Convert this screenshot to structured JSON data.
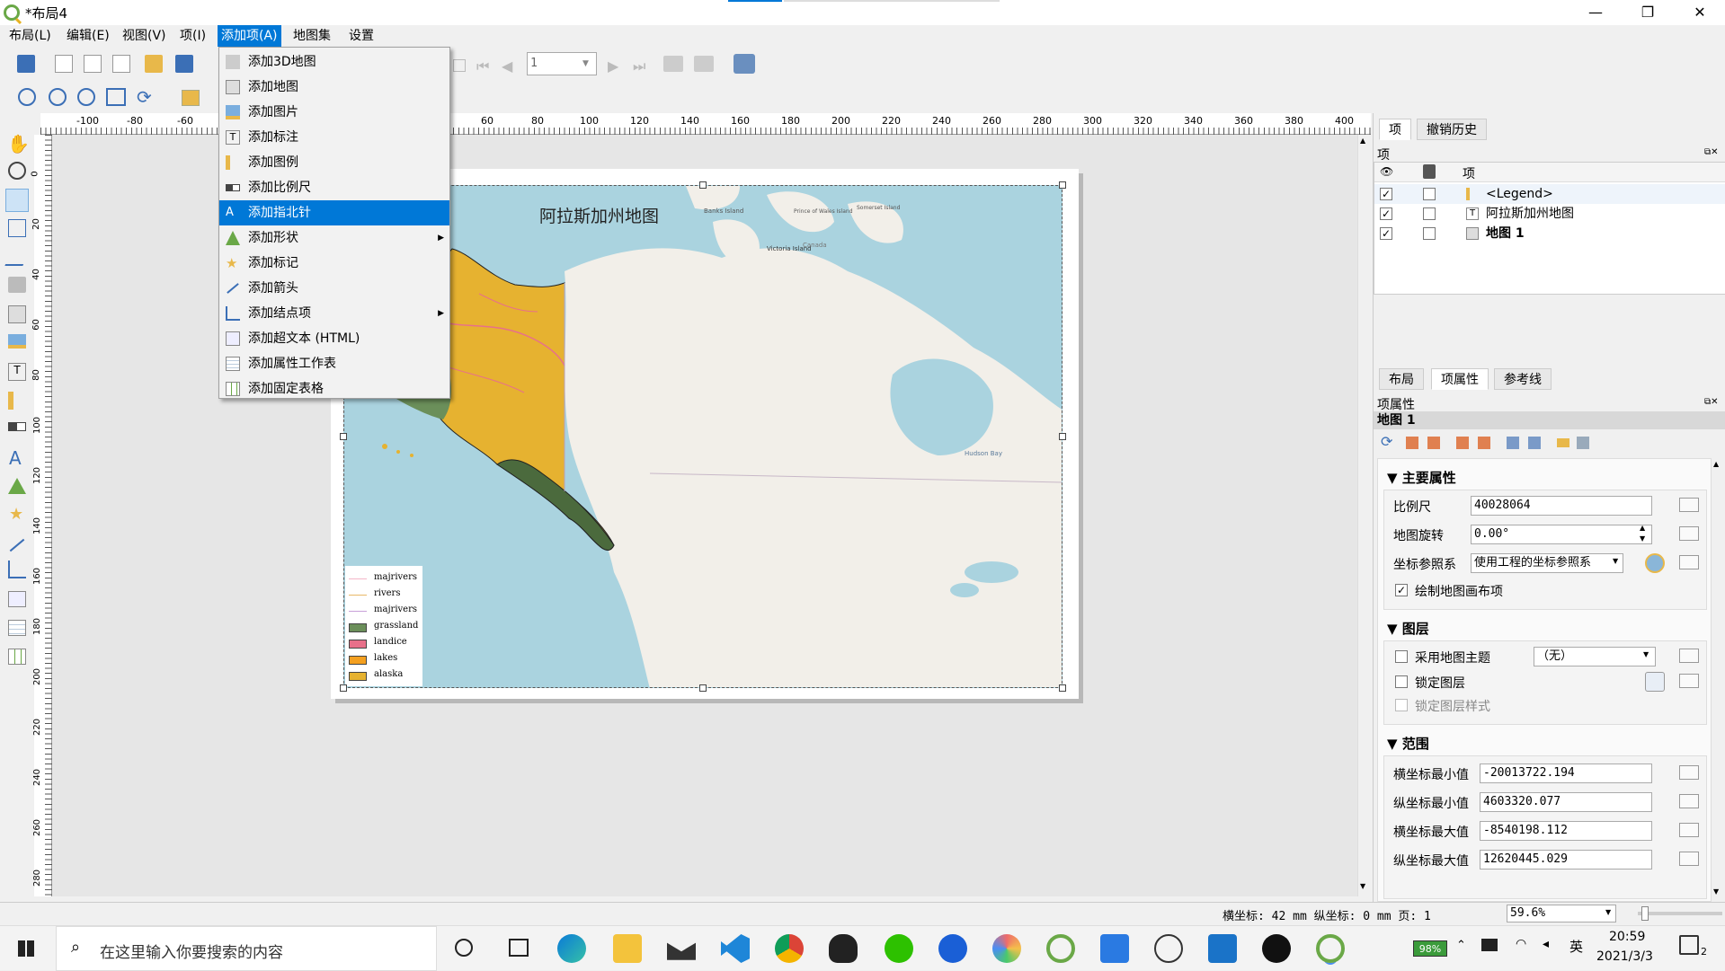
{
  "window": {
    "title": "*布局4",
    "min": "—",
    "max": "❐",
    "close": "✕"
  },
  "menubar": {
    "items": [
      "布局(L)",
      "编辑(E)",
      "视图(V)",
      "项(I)",
      "添加项(A)",
      "地图集",
      "设置"
    ]
  },
  "toolbar": {
    "page_value": "1"
  },
  "add_menu": {
    "items": [
      {
        "label": "添加3D地图",
        "icon": "3d-map-icon"
      },
      {
        "label": "添加地图",
        "icon": "map-icon"
      },
      {
        "label": "添加图片",
        "icon": "picture-icon"
      },
      {
        "label": "添加标注",
        "icon": "label-icon"
      },
      {
        "label": "添加图例",
        "icon": "legend-icon"
      },
      {
        "label": "添加比例尺",
        "icon": "scalebar-icon"
      },
      {
        "label": "添加指北针",
        "icon": "north-arrow-icon",
        "highlighted": true
      },
      {
        "label": "添加形状",
        "icon": "shape-icon",
        "submenu": true
      },
      {
        "label": "添加标记",
        "icon": "marker-icon"
      },
      {
        "label": "添加箭头",
        "icon": "arrow-icon"
      },
      {
        "label": "添加结点项",
        "icon": "node-item-icon",
        "submenu": true
      },
      {
        "label": "添加超文本 (HTML)",
        "icon": "html-icon"
      },
      {
        "label": "添加属性工作表",
        "icon": "attribute-table-icon"
      },
      {
        "label": "添加固定表格",
        "icon": "fixed-table-icon"
      }
    ]
  },
  "ruler": {
    "h_ticks": [
      "-100",
      "-80",
      "-60",
      "60",
      "80",
      "100",
      "120",
      "140",
      "160",
      "180",
      "200",
      "220",
      "240",
      "260",
      "280",
      "300",
      "320",
      "340",
      "360",
      "380",
      "400"
    ],
    "v_ticks": [
      "0",
      "20",
      "40",
      "60",
      "80",
      "100",
      "120",
      "140",
      "160",
      "180",
      "200",
      "220",
      "240",
      "260",
      "280"
    ]
  },
  "layout": {
    "map_title": "阿拉斯加州地图",
    "map_labels": [
      "Banks Island",
      "Prince of Wales Island",
      "Somerset Island",
      "Victoria Island",
      "Canada",
      "Hudson Bay"
    ],
    "legend": [
      {
        "label": "majrivers",
        "kind": "line",
        "color": "#f4b6c8"
      },
      {
        "label": "rivers",
        "kind": "line",
        "color": "#e8b868"
      },
      {
        "label": "majrivers",
        "kind": "line",
        "color": "#c8a0d8"
      },
      {
        "label": "grassland",
        "kind": "fill",
        "color": "#6b8f5a"
      },
      {
        "label": "landice",
        "kind": "fill",
        "color": "#e8708a"
      },
      {
        "label": "lakes",
        "kind": "fill",
        "color": "#f4a020"
      },
      {
        "label": "alaska",
        "kind": "fill",
        "color": "#e6b230"
      }
    ]
  },
  "items_panel": {
    "tabs": [
      "项",
      "撤销历史"
    ],
    "header": "项",
    "column": "项",
    "rows": [
      {
        "name": "<Legend>",
        "checked": true,
        "bold": false
      },
      {
        "name": "阿拉斯加州地图",
        "checked": true,
        "bold": false
      },
      {
        "name": "地图 1",
        "checked": true,
        "bold": true
      }
    ]
  },
  "props_panel": {
    "tabs": [
      "布局",
      "项属性",
      "参考线"
    ],
    "header": "项属性",
    "item_name": "地图 1",
    "main_section": "主要属性",
    "scale_label": "比例尺",
    "scale_value": "40028064",
    "rotation_label": "地图旋转",
    "rotation_value": "0.00°",
    "crs_label": "坐标参照系",
    "crs_value": "使用工程的坐标参照系",
    "draw_items_label": "绘制地图画布项",
    "layers_section": "图层",
    "theme_label": "采用地图主题",
    "theme_value": "（无）",
    "lock_layers_label": "锁定图层",
    "lock_styles_label": "锁定图层样式",
    "extent_section": "范围",
    "xmin_label": "横坐标最小值",
    "xmin_value": "-20013722.194",
    "ymin_label": "纵坐标最小值",
    "ymin_value": "4603320.077",
    "xmax_label": "横坐标最大值",
    "xmax_value": "-8540198.112",
    "ymax_label": "纵坐标最大值",
    "ymax_value": "12620445.029"
  },
  "statusbar": {
    "coords": "横坐标: 42 mm 纵坐标: 0 mm  页: 1",
    "zoom": "59.6%"
  },
  "taskbar": {
    "search_placeholder": "在这里输入你要搜索的内容",
    "battery": "98%",
    "ime": "英",
    "time": "20:59",
    "date": "2021/3/3",
    "notify": "2"
  }
}
